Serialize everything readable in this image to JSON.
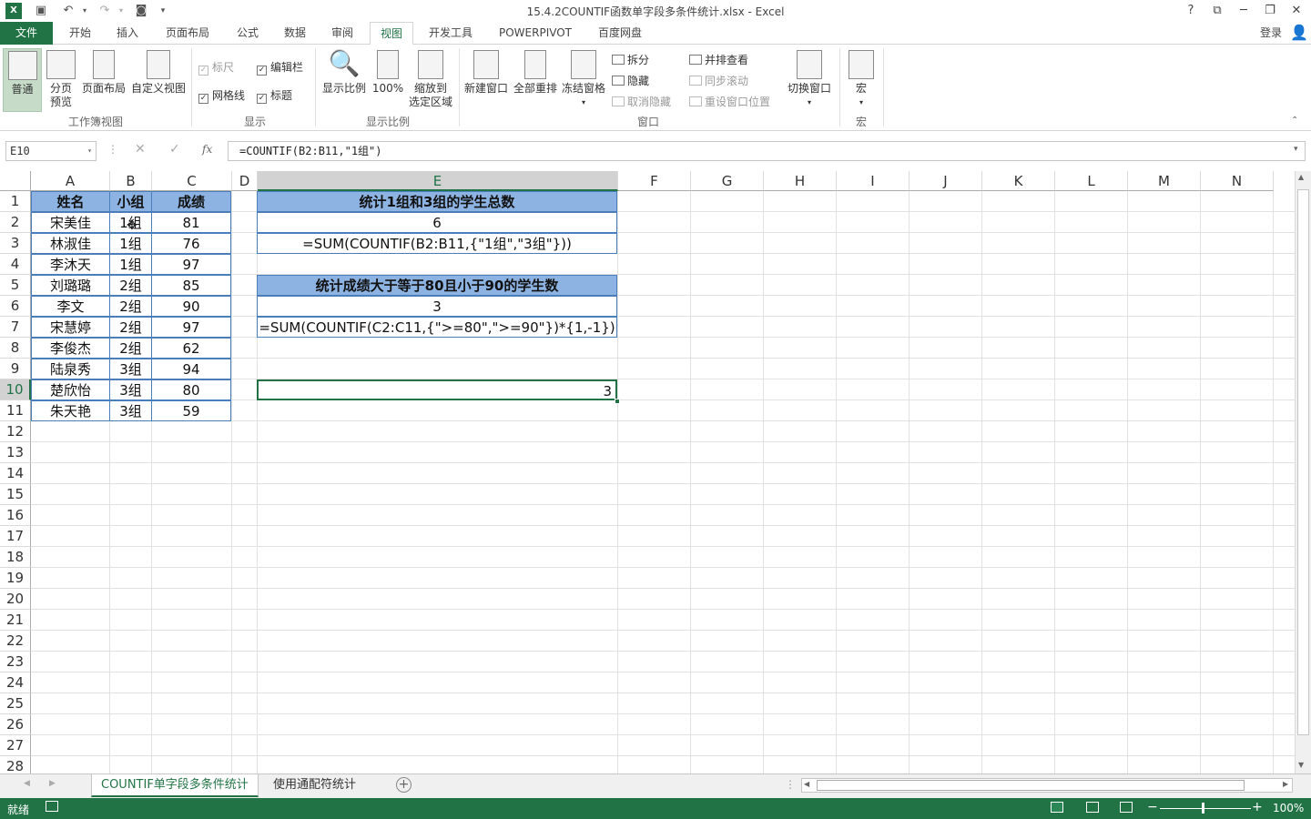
{
  "window": {
    "title": "15.4.2COUNTIF函数单字段多条件统计.xlsx - Excel",
    "help": "?",
    "login": "登录"
  },
  "tabs": [
    "文件",
    "开始",
    "插入",
    "页面布局",
    "公式",
    "数据",
    "审阅",
    "视图",
    "开发工具",
    "POWERPIVOT",
    "百度网盘"
  ],
  "active_tab": "视图",
  "ribbon": {
    "workbook_views": {
      "label": "工作簿视图",
      "normal": "普通",
      "page_break_1": "分页",
      "page_break_2": "预览",
      "page_layout": "页面布局",
      "custom": "自定义视图"
    },
    "show": {
      "label": "显示",
      "ruler": "标尺",
      "formula_bar": "编辑栏",
      "gridlines": "网格线",
      "headings": "标题"
    },
    "zoom": {
      "label": "显示比例",
      "zoom": "显示比例",
      "hundred": "100%",
      "zoom_sel_1": "缩放到",
      "zoom_sel_2": "选定区域"
    },
    "window": {
      "label": "窗口",
      "new": "新建窗口",
      "arrange": "全部重排",
      "freeze": "冻结窗格",
      "split": "拆分",
      "hide": "隐藏",
      "unhide": "取消隐藏",
      "side_by_side": "并排查看",
      "sync_scroll": "同步滚动",
      "reset_pos": "重设窗口位置",
      "switch": "切换窗口"
    },
    "macros": {
      "label": "宏",
      "macro": "宏"
    }
  },
  "formula_bar": {
    "name_box": "E10",
    "fx": "fx",
    "formula": "=COUNTIF(B2:B11,\"1组\")"
  },
  "columns": [
    "A",
    "B",
    "C",
    "D",
    "E",
    "F",
    "G",
    "H",
    "I",
    "J",
    "K",
    "L",
    "M",
    "N"
  ],
  "rows": [
    "1",
    "2",
    "3",
    "4",
    "5",
    "6",
    "7",
    "8",
    "9",
    "10",
    "11",
    "12",
    "13",
    "14",
    "15",
    "16",
    "17",
    "18",
    "19",
    "20",
    "21",
    "22",
    "23",
    "24",
    "25",
    "26",
    "27",
    "28"
  ],
  "table": {
    "headers": [
      "姓名",
      "小组",
      "成绩"
    ],
    "rows": [
      [
        "宋美佳",
        "1组",
        "81"
      ],
      [
        "林淑佳",
        "1组",
        "76"
      ],
      [
        "李沐天",
        "1组",
        "97"
      ],
      [
        "刘璐璐",
        "2组",
        "85"
      ],
      [
        "李文",
        "2组",
        "90"
      ],
      [
        "宋慧婷",
        "2组",
        "97"
      ],
      [
        "李俊杰",
        "2组",
        "62"
      ],
      [
        "陆泉秀",
        "3组",
        "94"
      ],
      [
        "楚欣怡",
        "3组",
        "80"
      ],
      [
        "朱天艳",
        "3组",
        "59"
      ]
    ]
  },
  "stats": {
    "e1": "统计1组和3组的学生总数",
    "e2": "6",
    "e3": "=SUM(COUNTIF(B2:B11,{\"1组\",\"3组\"}))",
    "e5": "统计成绩大于等于80且小于90的学生数",
    "e6": "3",
    "e7": "=SUM(COUNTIF(C2:C11,{\">=80\",\">=90\"})*{1,-1})",
    "e10": "3"
  },
  "sheets": [
    "COUNTIF单字段多条件统计",
    "使用通配符统计"
  ],
  "active_sheet": "COUNTIF单字段多条件统计",
  "status": {
    "ready": "就绪",
    "zoom": "100%"
  }
}
